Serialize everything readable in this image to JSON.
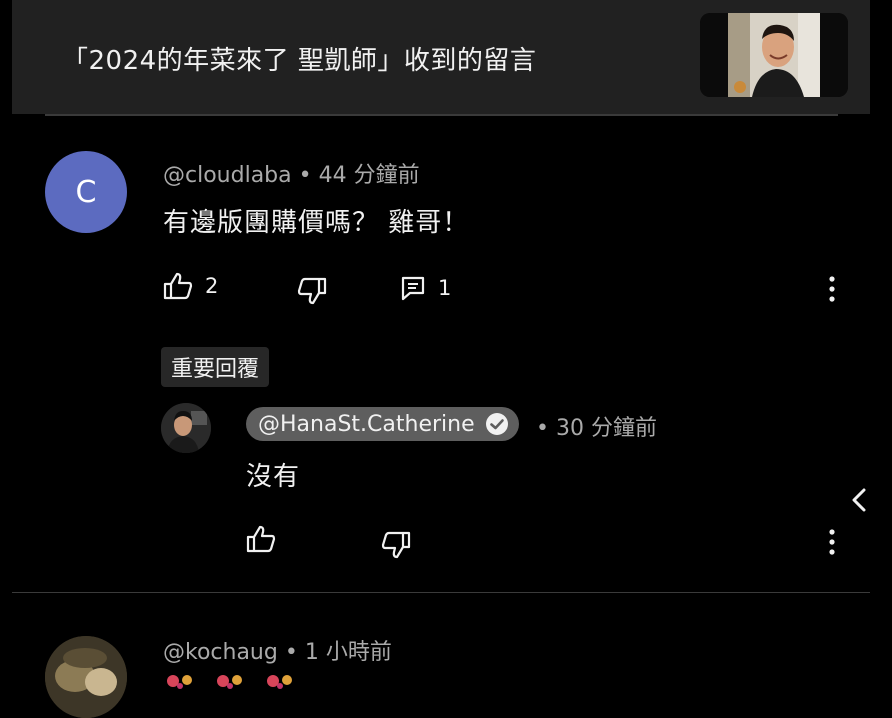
{
  "header": {
    "title": "「2024的年菜來了 聖凱師」收到的留言",
    "thumbnail_icon": "video-thumbnail-person"
  },
  "comments": [
    {
      "avatar_letter": "C",
      "author": "@cloudlaba",
      "time": "44 分鐘前",
      "text": "有邊版團購價嗎？ 雞哥！",
      "likes": "2",
      "replies": "1",
      "chip": "重要回覆",
      "reply": {
        "author": "@HanaSt.Catherine",
        "time": "30 分鐘前",
        "text": "沒有"
      }
    },
    {
      "author": "@kochaug",
      "time": "1 小時前"
    }
  ],
  "colors": {
    "background": "#000000",
    "header_bg": "#212121",
    "avatar_c": "#5c6bc0",
    "meta_text": "#aaaaaa",
    "owner_chip": "#5e5e5e"
  }
}
